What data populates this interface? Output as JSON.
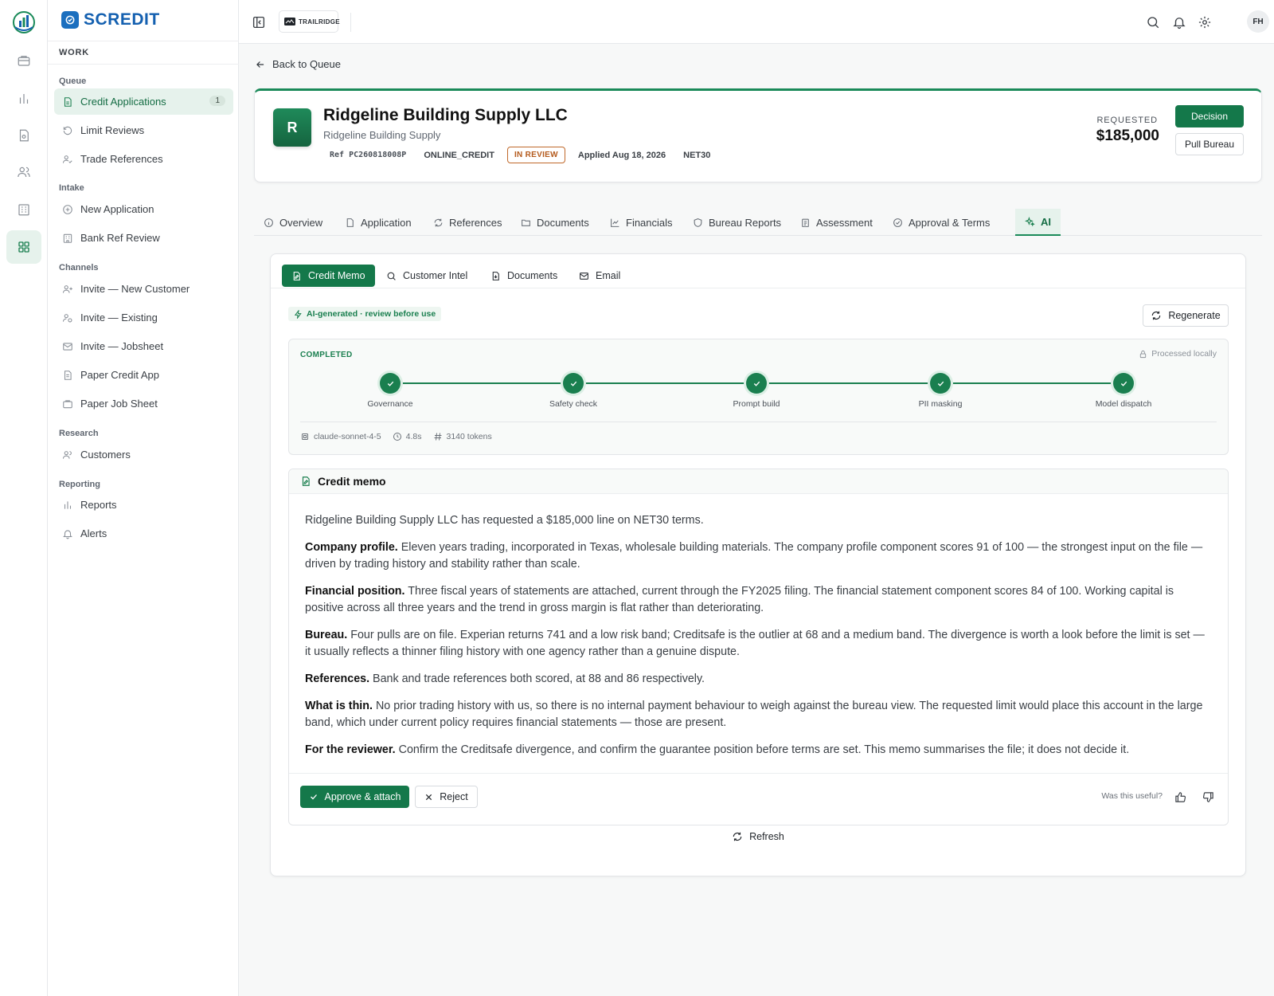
{
  "brand": {
    "name": "SCREDIT",
    "tenant": "TRAILRIDGE",
    "user_initials": "FH"
  },
  "sidebar": {
    "section_title": "WORK",
    "groups": [
      {
        "label": "Queue",
        "items": [
          {
            "label": "Credit Applications",
            "badge": "1",
            "icon": "file-text-icon",
            "active": true
          },
          {
            "label": "Limit Reviews",
            "icon": "history-icon"
          },
          {
            "label": "Trade References",
            "icon": "user-check-icon"
          }
        ]
      },
      {
        "label": "Intake",
        "items": [
          {
            "label": "New Application",
            "icon": "plus-circle-icon"
          },
          {
            "label": "Bank Ref Review",
            "icon": "bank-icon"
          }
        ]
      },
      {
        "label": "Channels",
        "items": [
          {
            "label": "Invite — New Customer",
            "icon": "user-plus-icon"
          },
          {
            "label": "Invite — Existing",
            "icon": "user-link-icon"
          },
          {
            "label": "Invite — Jobsheet",
            "icon": "mail-icon"
          },
          {
            "label": "Paper Credit App",
            "icon": "document-icon"
          },
          {
            "label": "Paper Job Sheet",
            "icon": "briefcase-icon"
          }
        ]
      },
      {
        "label": "Research",
        "items": [
          {
            "label": "Customers",
            "icon": "users-icon"
          }
        ]
      },
      {
        "label": "Reporting",
        "items": [
          {
            "label": "Reports",
            "icon": "bar-chart-icon"
          },
          {
            "label": "Alerts",
            "icon": "bell-icon"
          }
        ]
      }
    ]
  },
  "nav": {
    "back_label": "Back to Queue"
  },
  "header": {
    "avatar_letter": "R",
    "name": "Ridgeline Building Supply LLC",
    "subtitle": "Ridgeline Building Supply",
    "ref": "Ref PC260818008P",
    "channel": "ONLINE_CREDIT",
    "status": "IN REVIEW",
    "applied": "Applied Aug 18, 2026",
    "terms": "NET30",
    "requested_label": "REQUESTED",
    "requested_amount": "$185,000",
    "decision_label": "Decision",
    "pull_bureau_label": "Pull Bureau"
  },
  "tabs": [
    "Overview",
    "Application",
    "References",
    "Documents",
    "Financials",
    "Bureau Reports",
    "Assessment",
    "Approval & Terms",
    "AI"
  ],
  "active_tab": "AI",
  "ai": {
    "subtabs": [
      "Credit Memo",
      "Customer Intel",
      "Documents",
      "Email"
    ],
    "active_subtab": "Credit Memo",
    "badge": "AI-generated · review before use",
    "regenerate_label": "Regenerate",
    "status": {
      "label": "COMPLETED",
      "processed": "Processed locally",
      "steps": [
        "Governance",
        "Safety check",
        "Prompt build",
        "PII masking",
        "Model dispatch"
      ],
      "model": "claude-sonnet-4-5",
      "duration": "4.8s",
      "tokens": "3140 tokens"
    },
    "memo": {
      "title": "Credit memo",
      "intro": "Ridgeline Building Supply LLC has requested a $185,000 line on NET30 terms.",
      "sections": [
        {
          "heading": "Company profile.",
          "text": "Eleven years trading, incorporated in Texas, wholesale building materials. The company profile component scores 91 of 100 — the strongest input on the file — driven by trading history and stability rather than scale."
        },
        {
          "heading": "Financial position.",
          "text": "Three fiscal years of statements are attached, current through the FY2025 filing. The financial statement component scores 84 of 100. Working capital is positive across all three years and the trend in gross margin is flat rather than deteriorating."
        },
        {
          "heading": "Bureau.",
          "text": "Four pulls are on file. Experian returns 741 and a low risk band; Creditsafe is the outlier at 68 and a medium band. The divergence is worth a look before the limit is set — it usually reflects a thinner filing history with one agency rather than a genuine dispute."
        },
        {
          "heading": "References.",
          "text": "Bank and trade references both scored, at 88 and 86 respectively."
        },
        {
          "heading": "What is thin.",
          "text": "No prior trading history with us, so there is no internal payment behaviour to weigh against the bureau view. The requested limit would place this account in the large band, which under current policy requires financial statements — those are present."
        },
        {
          "heading": "For the reviewer.",
          "text": "Confirm the Creditsafe divergence, and confirm the guarantee position before terms are set. This memo summarises the file; it does not decide it."
        }
      ],
      "approve_label": "Approve & attach",
      "reject_label": "Reject",
      "feedback_prompt": "Was this useful?"
    },
    "refresh_label": "Refresh"
  },
  "colors": {
    "accent": "#14784a",
    "accent_light": "#e6f2ec",
    "status_review": "#b45a1c",
    "brand_blue": "#1460b0"
  }
}
